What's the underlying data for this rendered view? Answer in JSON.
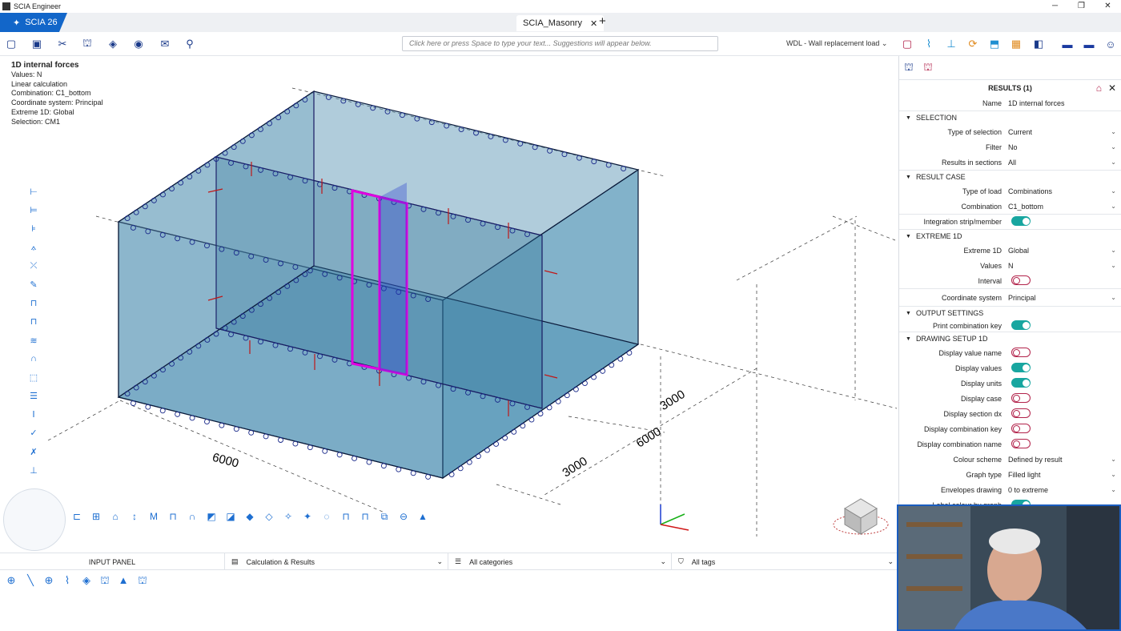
{
  "titlebar": {
    "app_name": "SCIA Engineer",
    "controls": [
      "─",
      "❐",
      "✕"
    ]
  },
  "tabs": {
    "product": "SCIA 26",
    "document": "SCIA_Masonry",
    "close": "✕",
    "add": "+"
  },
  "toolbar": {
    "command_placeholder": "Click here or press Space to type your text... Suggestions will appear below.",
    "load_case": "WDL - Wall replacement load"
  },
  "info": {
    "title": "1D internal forces",
    "lines": [
      "Values: N",
      "Linear calculation",
      "Combination: C1_bottom",
      "Coordinate system: Principal",
      "Extreme 1D: Global",
      "Selection: CM1"
    ]
  },
  "dimensions": [
    "6000",
    "3000",
    "6000",
    "3000"
  ],
  "bottom": {
    "input_panel": "INPUT PANEL",
    "workflow": "Calculation & Results",
    "categories": "All categories",
    "tags": "All tags"
  },
  "results_panel": {
    "title": "RESULTS (1)",
    "name_label": "Name",
    "name_value": "1D internal forces",
    "sections": {
      "selection": "SELECTION",
      "result_case": "RESULT CASE",
      "extreme": "EXTREME 1D",
      "output": "OUTPUT SETTINGS",
      "drawing": "DRAWING SETUP 1D"
    },
    "rows": {
      "type_of_selection": {
        "label": "Type of selection",
        "value": "Current"
      },
      "filter": {
        "label": "Filter",
        "value": "No"
      },
      "results_in_sections": {
        "label": "Results in sections",
        "value": "All"
      },
      "type_of_load": {
        "label": "Type of load",
        "value": "Combinations"
      },
      "combination": {
        "label": "Combination",
        "value": "C1_bottom"
      },
      "integration": {
        "label": "Integration strip/member",
        "on": true
      },
      "extreme_1d": {
        "label": "Extreme 1D",
        "value": "Global"
      },
      "values": {
        "label": "Values",
        "value": "N"
      },
      "interval": {
        "label": "Interval",
        "on": false
      },
      "coord_system": {
        "label": "Coordinate system",
        "value": "Principal"
      },
      "print_combination_key": {
        "label": "Print combination key",
        "on": true
      },
      "display_value_name": {
        "label": "Display value name",
        "on": false
      },
      "display_values": {
        "label": "Display values",
        "on": true
      },
      "display_units": {
        "label": "Display units",
        "on": true
      },
      "display_case": {
        "label": "Display case",
        "on": false
      },
      "display_section_dx": {
        "label": "Display section dx",
        "on": false
      },
      "display_combination_key": {
        "label": "Display combination key",
        "on": false
      },
      "display_combination_name": {
        "label": "Display combination name",
        "on": false
      },
      "colour_scheme": {
        "label": "Colour scheme",
        "value": "Defined by result"
      },
      "graph_type": {
        "label": "Graph type",
        "value": "Filled light"
      },
      "envelopes_drawing": {
        "label": "Envelopes drawing",
        "value": "0 to extreme"
      },
      "label_colour_by_graph": {
        "label": "Label colour by graph",
        "on": true
      }
    }
  },
  "colors": {
    "accent": "#1266c9",
    "toggle_on": "#18a6a0",
    "toggle_off": "#b2234b",
    "highlight": "#e000e0",
    "wall": "#4f8fb0"
  }
}
